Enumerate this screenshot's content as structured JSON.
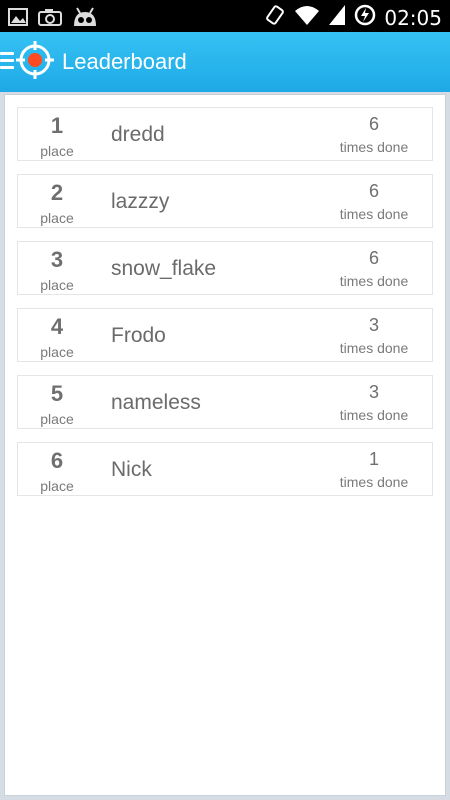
{
  "statusbar": {
    "time": "02:05",
    "left_icons": [
      "image-icon",
      "camera-icon",
      "android-icon"
    ],
    "right_icons": [
      "rotate-icon",
      "wifi-icon",
      "signal-icon",
      "battery-charging-icon"
    ]
  },
  "appbar": {
    "title": "Leaderboard"
  },
  "leaderboard": {
    "rows": [
      {
        "rank": "1",
        "place_label": "place",
        "name": "dredd",
        "count": "6",
        "count_label": "times done"
      },
      {
        "rank": "2",
        "place_label": "place",
        "name": "lazzzy",
        "count": "6",
        "count_label": "times done"
      },
      {
        "rank": "3",
        "place_label": "place",
        "name": "snow_flake",
        "count": "6",
        "count_label": "times done"
      },
      {
        "rank": "4",
        "place_label": "place",
        "name": "Frodo",
        "count": "3",
        "count_label": "times done"
      },
      {
        "rank": "5",
        "place_label": "place",
        "name": "nameless",
        "count": "3",
        "count_label": "times done"
      },
      {
        "rank": "6",
        "place_label": "place",
        "name": "Nick",
        "count": "1",
        "count_label": "times done"
      }
    ]
  },
  "colors": {
    "appbar_top": "#35c2f3",
    "appbar_bottom": "#1ea9e6",
    "accent_red": "#ff4b1f",
    "text_gray": "#6f6f6f"
  }
}
